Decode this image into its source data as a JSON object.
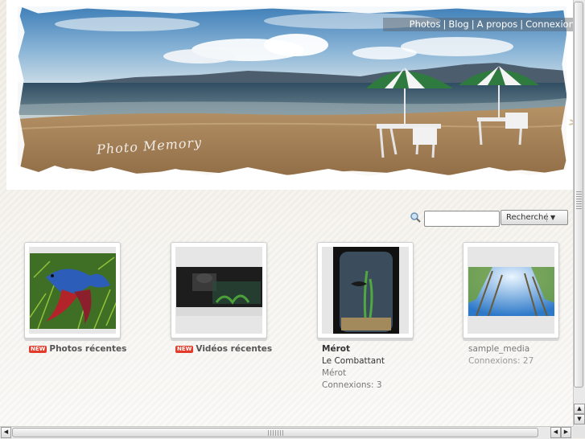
{
  "nav": {
    "separator": "|",
    "items": [
      {
        "label": "Photos"
      },
      {
        "label": "Blog"
      },
      {
        "label": "A propos"
      },
      {
        "label": "Connexion"
      }
    ]
  },
  "banner": {
    "caption": "Photo Memory"
  },
  "search": {
    "icon": "magnifier-icon",
    "input_value": "",
    "button_label": "Recherche",
    "dropdown_icon": "triangle-down"
  },
  "cards": [
    {
      "badge": "NEW",
      "title": "Photos récentes"
    },
    {
      "badge": "NEW",
      "title": "Vidéos récentes"
    },
    {
      "name": "Mérot",
      "subtitle": "Le Combattant",
      "owner": "Mérot",
      "connections": "Connexions: 3"
    },
    {
      "name": "sample_media",
      "connections": "Connexions: 27"
    }
  ],
  "scrollbars": {
    "up_icon": "arrow-up-icon",
    "down_icon": "arrow-down-icon",
    "left_icon": "arrow-left-icon",
    "right_icon": "arrow-right-icon"
  }
}
